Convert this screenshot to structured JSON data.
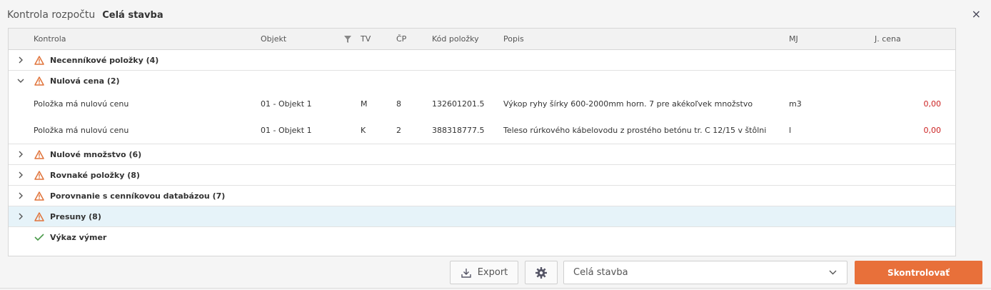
{
  "dialog": {
    "title": "Kontrola rozpočtu",
    "subtitle": "Celá stavba",
    "close_label": "×"
  },
  "columns": {
    "kontrola": "Kontrola",
    "objekt": "Objekt",
    "tv": "TV",
    "cp": "ČP",
    "kod": "Kód položky",
    "popis": "Popis",
    "mj": "MJ",
    "jcena": "J. cena"
  },
  "groups": [
    {
      "label": "Necenníkové položky (4)",
      "status": "warning",
      "expanded": false
    },
    {
      "label": "Nulová cena (2)",
      "status": "warning",
      "expanded": true
    },
    {
      "label": "Nulové množstvo (6)",
      "status": "warning",
      "expanded": false
    },
    {
      "label": "Rovnaké položky (8)",
      "status": "warning",
      "expanded": false
    },
    {
      "label": "Porovnanie s cenníkovou databázou (7)",
      "status": "warning",
      "expanded": false
    },
    {
      "label": "Presuny (8)",
      "status": "warning",
      "expanded": false,
      "selected": true
    },
    {
      "label": "Výkaz výmer",
      "status": "ok",
      "expanded": false
    }
  ],
  "detail_rows": [
    {
      "kontrola": "Položka má nulovú cenu",
      "objekt": "01 - Objekt 1",
      "tv": "M",
      "cp": "8",
      "kod": "132601201.5",
      "popis": "Výkop ryhy šírky 600-2000mm horn. 7 pre akékoľvek množstvo",
      "mj": "m3",
      "jcena": "0,00"
    },
    {
      "kontrola": "Položka má nulovú cenu",
      "objekt": "01 - Objekt 1",
      "tv": "K",
      "cp": "2",
      "kod": "388318777.5",
      "popis": "Teleso rúrkového kábelovodu z prostého betónu tr. C 12/15 v štôlni",
      "mj": "l",
      "jcena": "0,00"
    }
  ],
  "footer": {
    "export_label": "Export",
    "scope_value": "Celá stavba",
    "submit_label": "Skontrolovať"
  },
  "colors": {
    "accent": "#e8703a",
    "warning": "#e0733a",
    "ok": "#4a9a4a",
    "negative": "#cc2222",
    "selected_row": "#e6f3f9"
  }
}
